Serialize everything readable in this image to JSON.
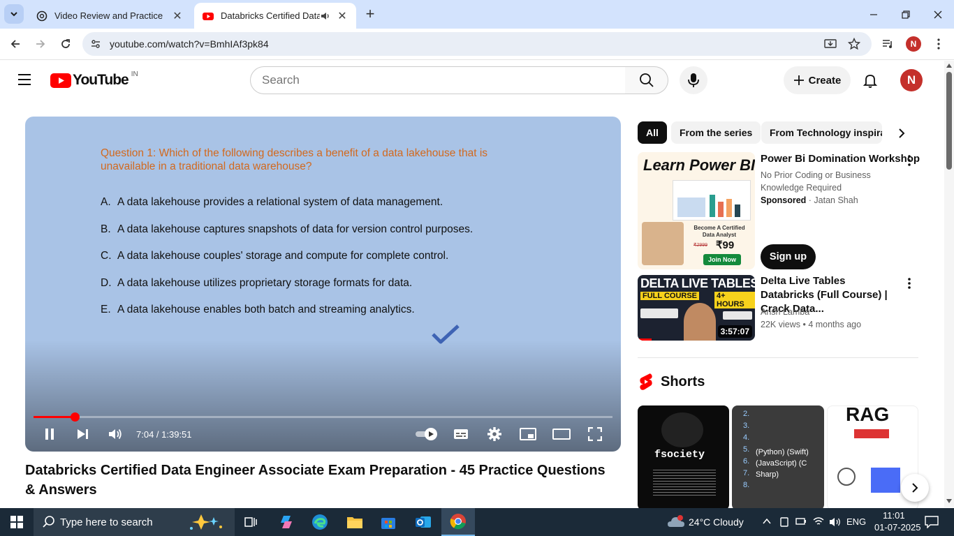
{
  "browser": {
    "tabs": [
      {
        "title": "Video Review and Practice",
        "active": false
      },
      {
        "title": "Databricks Certified Data Engineer Associate Exam Preparation",
        "active": true
      }
    ],
    "url": "youtube.com/watch?v=BmhIAf3pk84",
    "profile_initial": "N"
  },
  "header": {
    "logo_text": "YouTube",
    "country": "IN",
    "search_placeholder": "Search",
    "create_label": "Create",
    "avatar_initial": "N"
  },
  "player": {
    "question": "Question 1:  Which of the following describes a benefit of a data lakehouse that is unavailable in a traditional data warehouse?",
    "options": [
      {
        "letter": "A.",
        "text": "A data lakehouse provides a relational system of data management."
      },
      {
        "letter": "B.",
        "text": "A data lakehouse captures snapshots of data for version control purposes."
      },
      {
        "letter": "C.",
        "text": "A data lakehouse couples' storage and compute for complete control."
      },
      {
        "letter": "D.",
        "text": "A data lakehouse utilizes proprietary storage formats for data."
      },
      {
        "letter": "E.",
        "text": "A data lakehouse enables both batch and streaming analytics."
      }
    ],
    "correct_option": "E",
    "time_display": "7:04 / 1:39:51",
    "progress_fraction": 0.0708
  },
  "video": {
    "title": "Databricks Certified Data Engineer Associate Exam Preparation - 45 Practice Questions & Answers"
  },
  "sidebar": {
    "chips": [
      "All",
      "From the series",
      "From Technology inspirat"
    ],
    "ad": {
      "thumb_title": "Learn Power BI",
      "thumb_price": "₹99",
      "thumb_strike": "₹2999",
      "thumb_cta": "Join Now",
      "thumb_badge": "Become A Certified Data Analyst",
      "title": "Power Bi Domination Workshop",
      "description": "No Prior Coding or Business Knowledge Required",
      "sponsored_label": "Sponsored",
      "advertiser": "Jatan Shah",
      "cta_label": "Sign up"
    },
    "recommendation": {
      "thumb_heading": "DELTA LIVE TABLES",
      "thumb_sub1": "FULL COURSE",
      "thumb_sub2": "4+ HOURS",
      "title": "Delta Live Tables Databricks (Full Course) | Crack Data...",
      "channel": "Ansh Lamba",
      "views": "22K views",
      "age": "4 months ago",
      "duration": "3:57:07"
    },
    "shorts_heading": "Shorts",
    "shorts": [
      {
        "label": "fsociety"
      },
      {
        "label": "(Python) (Swift) (JavaScript) (C Sharp)"
      },
      {
        "label": "RAG"
      }
    ]
  },
  "taskbar": {
    "search_placeholder": "Type here to search",
    "weather": "24°C  Cloudy",
    "language": "ENG",
    "time": "11:01",
    "date": "01-07-2025"
  },
  "colors": {
    "youtube_red": "#ff0000",
    "tab_strip": "#d3e3fd",
    "player_bg": "#a9c3e6",
    "question_color": "#d2691e",
    "taskbar": "#1b2a38"
  }
}
